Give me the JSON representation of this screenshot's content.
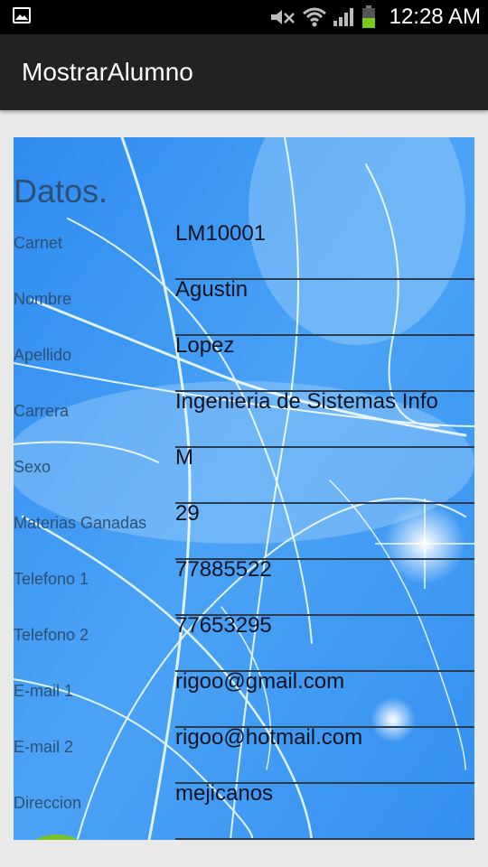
{
  "status_bar": {
    "time": "12:28 AM",
    "icons": [
      "image-notification-icon",
      "mute-icon",
      "wifi-icon",
      "signal-icon",
      "battery-icon"
    ]
  },
  "action_bar": {
    "title": "MostrarAlumno"
  },
  "form": {
    "heading": "Datos.",
    "rows": [
      {
        "label": "Carnet",
        "value": "LM10001"
      },
      {
        "label": "Nombre",
        "value": "Agustin"
      },
      {
        "label": "Apellido",
        "value": "Lopez"
      },
      {
        "label": "Carrera",
        "value": "Ingenieria de Sistemas Info"
      },
      {
        "label": "Sexo",
        "value": "M"
      },
      {
        "label": "Materias Ganadas",
        "value": "29"
      },
      {
        "label": "Telefono 1",
        "value": "77885522"
      },
      {
        "label": "Telefono 2",
        "value": "77653295"
      },
      {
        "label": "E-mail 1",
        "value": "rigoo@gmail.com"
      },
      {
        "label": "E-mail 2",
        "value": "rigoo@hotmail.com"
      },
      {
        "label": "Direccion",
        "value": "mejicanos"
      }
    ]
  },
  "colors": {
    "background_blue": "#3a93f0",
    "label_text": "#2f4f73",
    "value_text": "#0b1320",
    "action_bar": "#222222"
  }
}
